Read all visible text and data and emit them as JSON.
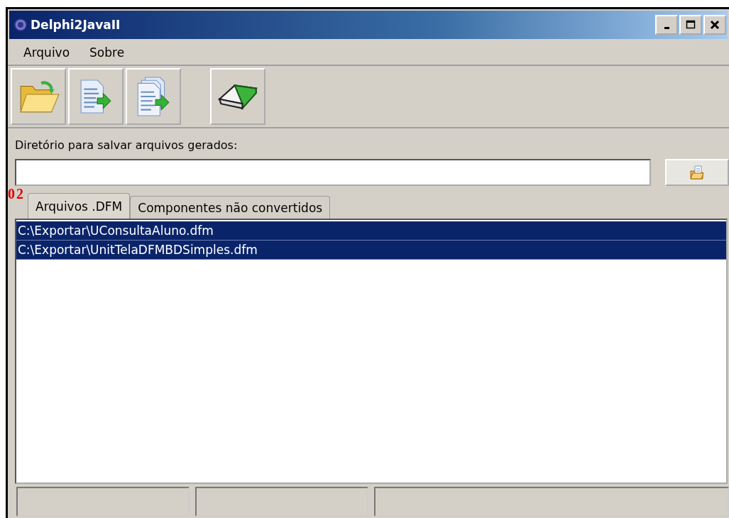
{
  "window": {
    "title": "Delphi2JavaII"
  },
  "menu": [
    {
      "label": "Arquivo"
    },
    {
      "label": "Sobre"
    }
  ],
  "toolbar": [
    {
      "kind": "open"
    },
    {
      "kind": "convert"
    },
    {
      "kind": "convert-all"
    },
    {
      "kind": "gap"
    },
    {
      "kind": "erase"
    }
  ],
  "directory": {
    "label": "Diretório para salvar arquivos gerados:"
  },
  "annotation": "02",
  "tabs": [
    {
      "label": "Arquivos .DFM",
      "selected": true
    },
    {
      "label": "Componentes não convertidos",
      "selected": false
    }
  ],
  "files": [
    {
      "path": "C:\\Exportar\\UConsultaAluno.dfm",
      "selected": true
    },
    {
      "path": "C:\\Exportar\\UnitTelaDFMBDSimples.dfm",
      "selected": true
    }
  ]
}
